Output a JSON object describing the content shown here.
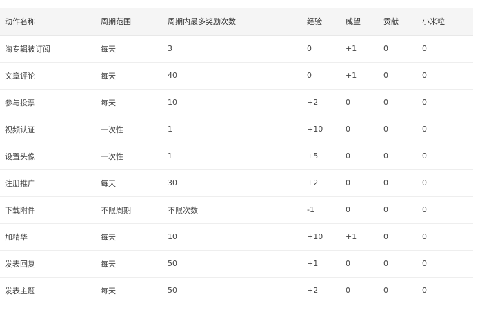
{
  "table": {
    "headers": [
      "动作名称",
      "周期范围",
      "周期内最多奖励次数",
      "经验",
      "威望",
      "贡献",
      "小米粒"
    ],
    "rows": [
      [
        "淘专辑被订阅",
        "每天",
        "3",
        "0",
        "+1",
        "0",
        "0"
      ],
      [
        "文章评论",
        "每天",
        "40",
        "0",
        "+1",
        "0",
        "0"
      ],
      [
        "参与投票",
        "每天",
        "10",
        "+2",
        "0",
        "0",
        "0"
      ],
      [
        "视频认证",
        "一次性",
        "1",
        "+10",
        "0",
        "0",
        "0"
      ],
      [
        "设置头像",
        "一次性",
        "1",
        "+5",
        "0",
        "0",
        "0"
      ],
      [
        "注册推广",
        "每天",
        "30",
        "+2",
        "0",
        "0",
        "0"
      ],
      [
        "下载附件",
        "不限周期",
        "不限次数",
        "-1",
        "0",
        "0",
        "0"
      ],
      [
        "加精华",
        "每天",
        "10",
        "+10",
        "+1",
        "0",
        "0"
      ],
      [
        "发表回复",
        "每天",
        "50",
        "+1",
        "0",
        "0",
        "0"
      ],
      [
        "发表主题",
        "每天",
        "50",
        "+2",
        "0",
        "0",
        "0"
      ]
    ]
  }
}
